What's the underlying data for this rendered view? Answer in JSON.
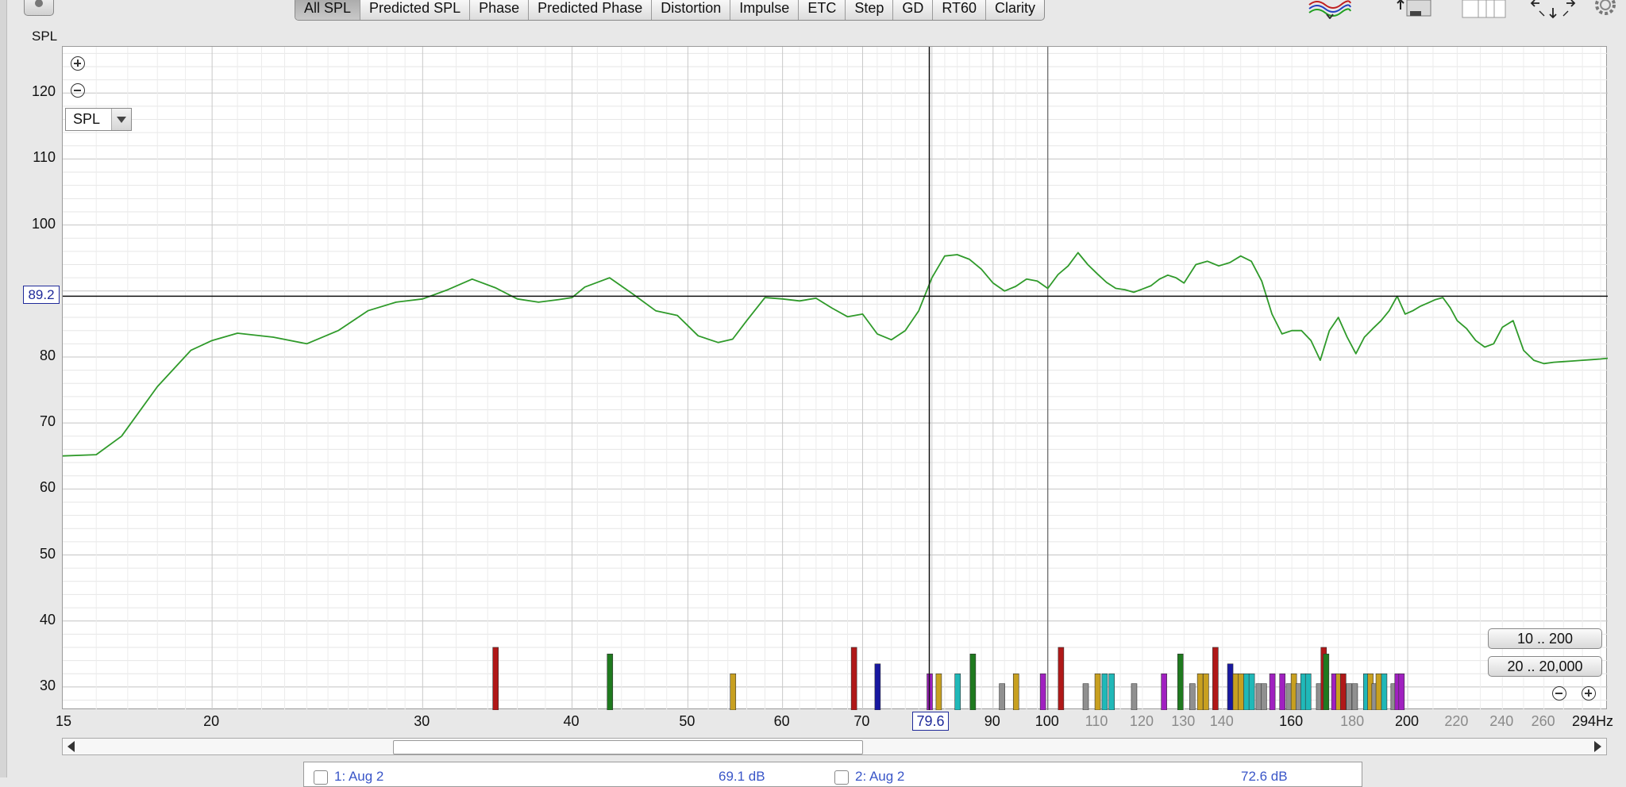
{
  "toolbar": {
    "tabs": [
      "All SPL",
      "Predicted SPL",
      "Phase",
      "Predicted Phase",
      "Distortion",
      "Impulse",
      "ETC",
      "Step",
      "GD",
      "RT60",
      "Clarity"
    ],
    "active_tab": "All SPL",
    "icons": [
      "camera-icon",
      "traces-icon",
      "limits-icon",
      "layout-icon",
      "arrows-icon",
      "gear-icon"
    ]
  },
  "plot": {
    "y_axis_title": "SPL",
    "y_labels": [
      "120",
      "110",
      "100",
      "80",
      "70",
      "60",
      "50",
      "40",
      "30"
    ],
    "x_labels": [
      {
        "text": "15",
        "grey": false
      },
      {
        "text": "20",
        "grey": false
      },
      {
        "text": "30",
        "grey": false
      },
      {
        "text": "40",
        "grey": false
      },
      {
        "text": "50",
        "grey": false
      },
      {
        "text": "60",
        "grey": false
      },
      {
        "text": "70",
        "grey": false
      },
      {
        "text": "90",
        "grey": false
      },
      {
        "text": "100",
        "grey": false
      },
      {
        "text": "110",
        "grey": true
      },
      {
        "text": "120",
        "grey": true
      },
      {
        "text": "130",
        "grey": true
      },
      {
        "text": "140",
        "grey": true
      },
      {
        "text": "160",
        "grey": false
      },
      {
        "text": "180",
        "grey": true
      },
      {
        "text": "200",
        "grey": false
      },
      {
        "text": "220",
        "grey": true
      },
      {
        "text": "240",
        "grey": true
      },
      {
        "text": "260",
        "grey": true
      },
      {
        "text": "294Hz",
        "grey": false
      }
    ],
    "cursor_spl": "89.2",
    "cursor_freq": "79.6",
    "dropdown_value": "SPL",
    "range_buttons": [
      "10 .. 200",
      "20 .. 20,000"
    ],
    "trace_color": "#2f9a2a"
  },
  "chart_data": {
    "type": "line",
    "x_scale": "log",
    "xlim": [
      15,
      294
    ],
    "ylim": [
      26.5,
      127
    ],
    "xlabel": "",
    "ylabel": "SPL",
    "x": [
      15,
      16,
      16.8,
      18,
      19.2,
      20,
      21,
      22.5,
      24,
      25.5,
      27,
      28.5,
      30,
      31.5,
      33,
      34.5,
      36,
      37.5,
      39,
      40,
      41,
      43,
      45,
      47,
      49,
      51,
      53,
      54.5,
      56,
      58,
      60,
      62,
      64,
      66,
      68,
      70,
      72,
      74,
      76,
      78,
      80,
      82,
      84,
      86,
      88,
      90,
      92,
      94,
      96,
      98,
      100,
      102,
      104,
      106,
      108,
      110,
      112,
      114,
      116,
      118,
      120,
      122,
      124,
      126,
      128,
      130,
      133,
      136,
      139,
      142,
      145,
      148,
      151,
      154,
      157,
      160,
      163,
      166,
      169,
      172,
      175,
      178,
      181,
      184,
      187,
      190,
      193,
      196,
      199,
      202,
      205,
      208,
      211,
      214,
      217,
      220,
      224,
      228,
      232,
      236,
      240,
      245,
      250,
      255,
      260,
      265,
      270,
      275,
      280,
      285,
      290,
      294
    ],
    "y": [
      65,
      65.2,
      68,
      75.5,
      81,
      82.5,
      83.6,
      83,
      82,
      84,
      87,
      88.3,
      88.8,
      90.2,
      91.8,
      90.5,
      88.8,
      88.3,
      88.7,
      89,
      90.6,
      92,
      89.5,
      87,
      86.3,
      83.2,
      82.2,
      82.7,
      85.5,
      89,
      88.8,
      88.5,
      88.9,
      87.4,
      86.1,
      86.5,
      83.5,
      82.6,
      84,
      87,
      92,
      95.3,
      95.5,
      94.8,
      93.3,
      91.2,
      90,
      90.7,
      91.8,
      91.5,
      90.4,
      92.5,
      93.8,
      95.8,
      94,
      92.6,
      91.3,
      90.4,
      90.2,
      89.8,
      90.3,
      90.8,
      91.8,
      92.4,
      92,
      91.2,
      94,
      94.5,
      93.8,
      94.3,
      95.3,
      94.5,
      91.5,
      86.5,
      83.5,
      84,
      84,
      82.5,
      79.5,
      84,
      86,
      83,
      80.5,
      83,
      84.3,
      85.5,
      87,
      89.2,
      86.5,
      87,
      87.7,
      88.2,
      88.7,
      89,
      87.5,
      85.5,
      84.3,
      82.5,
      81.5,
      82,
      84.5,
      85.5,
      81,
      79.5,
      79,
      79.2,
      79.3,
      79.4,
      79.5,
      79.6,
      79.7,
      79.8
    ],
    "series": [
      {
        "color": "#2f9a2a"
      }
    ],
    "grid": true,
    "cursor": {
      "freq": 79.6,
      "spl": 89.2
    },
    "marker_line_freq": 100,
    "filter_markers": [
      {
        "f": 34.5,
        "color": "#b01818",
        "h": 36
      },
      {
        "f": 43,
        "color": "#1f7a1f",
        "h": 35
      },
      {
        "f": 54.5,
        "color": "#c8a020",
        "h": 32
      },
      {
        "f": 68.8,
        "color": "#b01818",
        "h": 36
      },
      {
        "f": 72,
        "color": "#1818a0",
        "h": 33.5
      },
      {
        "f": 79.6,
        "color": "#a020c0",
        "h": 32
      },
      {
        "f": 81,
        "color": "#c8a020",
        "h": 32
      },
      {
        "f": 84,
        "color": "#20b8b8",
        "h": 32
      },
      {
        "f": 86.5,
        "color": "#1f7a1f",
        "h": 35
      },
      {
        "f": 91.5,
        "color": "#909090",
        "h": 30.5
      },
      {
        "f": 94,
        "color": "#c8a020",
        "h": 32
      },
      {
        "f": 99,
        "color": "#a020c0",
        "h": 32
      },
      {
        "f": 102.5,
        "color": "#b01818",
        "h": 36
      },
      {
        "f": 107.5,
        "color": "#909090",
        "h": 30.5
      },
      {
        "f": 110,
        "color": "#c8a020",
        "h": 32
      },
      {
        "f": 111.5,
        "color": "#20b8b8",
        "h": 32
      },
      {
        "f": 113,
        "color": "#20b8b8",
        "h": 32
      },
      {
        "f": 118,
        "color": "#909090",
        "h": 30.5
      },
      {
        "f": 125,
        "color": "#a020c0",
        "h": 32
      },
      {
        "f": 129,
        "color": "#1f7a1f",
        "h": 35
      },
      {
        "f": 132,
        "color": "#909090",
        "h": 30.5
      },
      {
        "f": 134,
        "color": "#c8a020",
        "h": 32
      },
      {
        "f": 135.5,
        "color": "#c8a020",
        "h": 32
      },
      {
        "f": 138,
        "color": "#b01818",
        "h": 36
      },
      {
        "f": 142,
        "color": "#1818a0",
        "h": 33.5
      },
      {
        "f": 143.5,
        "color": "#c8a020",
        "h": 32
      },
      {
        "f": 145,
        "color": "#c8a020",
        "h": 32
      },
      {
        "f": 146.5,
        "color": "#20b8b8",
        "h": 32
      },
      {
        "f": 148,
        "color": "#20b8b8",
        "h": 32
      },
      {
        "f": 150,
        "color": "#909090",
        "h": 30.5
      },
      {
        "f": 151.5,
        "color": "#909090",
        "h": 30.5
      },
      {
        "f": 154,
        "color": "#a020c0",
        "h": 32
      },
      {
        "f": 157,
        "color": "#a020c0",
        "h": 32
      },
      {
        "f": 159,
        "color": "#909090",
        "h": 30.5
      },
      {
        "f": 160.5,
        "color": "#c8a020",
        "h": 32
      },
      {
        "f": 162,
        "color": "#909090",
        "h": 30.5
      },
      {
        "f": 163.5,
        "color": "#20b8b8",
        "h": 32
      },
      {
        "f": 165,
        "color": "#20b8b8",
        "h": 32
      },
      {
        "f": 168.5,
        "color": "#909090",
        "h": 30.5
      },
      {
        "f": 170,
        "color": "#b01818",
        "h": 36
      },
      {
        "f": 170.8,
        "color": "#1f7a1f",
        "h": 35
      },
      {
        "f": 173.5,
        "color": "#a020c0",
        "h": 32
      },
      {
        "f": 175,
        "color": "#c8a020",
        "h": 32
      },
      {
        "f": 176.5,
        "color": "#b01818",
        "h": 32
      },
      {
        "f": 178.5,
        "color": "#909090",
        "h": 30.5
      },
      {
        "f": 180.5,
        "color": "#909090",
        "h": 30.5
      },
      {
        "f": 184.5,
        "color": "#20b8b8",
        "h": 32
      },
      {
        "f": 186,
        "color": "#c8a020",
        "h": 32
      },
      {
        "f": 187.5,
        "color": "#909090",
        "h": 30.5
      },
      {
        "f": 189,
        "color": "#c8a020",
        "h": 32
      },
      {
        "f": 191,
        "color": "#20b8b8",
        "h": 32
      },
      {
        "f": 194.5,
        "color": "#909090",
        "h": 30.5
      },
      {
        "f": 196,
        "color": "#a020c0",
        "h": 32
      },
      {
        "f": 197.5,
        "color": "#a020c0",
        "h": 32
      }
    ]
  },
  "scrollbar": {
    "thumb_start": 0.214,
    "thumb_end": 0.517
  },
  "legend_strip": {
    "items": [
      {
        "label": "1: Aug 2",
        "value": "69.1 dB"
      },
      {
        "label": "2: Aug 2",
        "value": "72.6 dB"
      }
    ]
  }
}
